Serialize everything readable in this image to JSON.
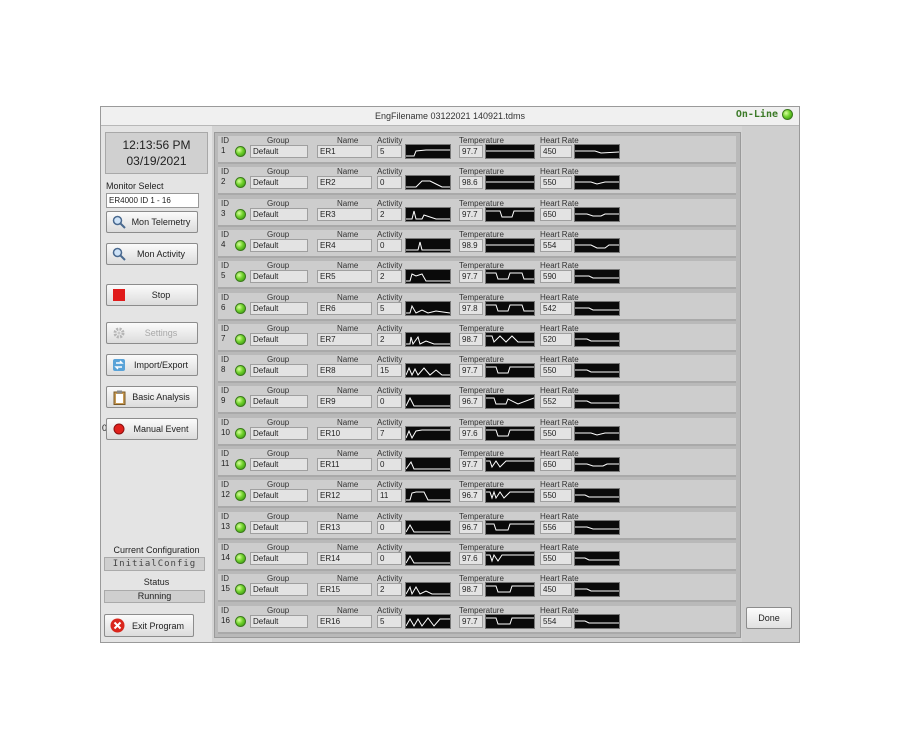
{
  "window": {
    "title": "EngFilename 03122021 140921.tdms",
    "online_label": "On-Line"
  },
  "left_panel": {
    "time": "12:13:56 PM",
    "date": "03/19/2021",
    "monitor_select_label": "Monitor Select",
    "monitor_select_value": "ER4000 ID 1 - 16",
    "buttons": [
      {
        "label": "Mon Telemetry",
        "icon": "magnifier-icon"
      },
      {
        "label": "Mon Activity",
        "icon": "magnifier-icon"
      },
      {
        "label": "Stop",
        "icon": "stop-square-icon"
      },
      {
        "label": "Settings",
        "icon": "gear-icon"
      },
      {
        "label": "Import/Export",
        "icon": "import-export-icon"
      },
      {
        "label": "Basic Analysis",
        "icon": "clipboard-icon"
      },
      {
        "label": "Manual Event",
        "icon": "red-dot-icon"
      }
    ],
    "manual_event_count": "0",
    "current_config_label": "Current Configuration",
    "current_config_value": "InitialConfig",
    "status_label": "Status",
    "status_value": "Running",
    "exit_label": "Exit Program"
  },
  "headers": {
    "id": "ID",
    "group": "Group",
    "name": "Name",
    "activity": "Activity",
    "temperature": "Temperature",
    "heart_rate": "Heart Rate"
  },
  "monitors": [
    {
      "id": "1",
      "group": "Default",
      "name": "ER1",
      "activity": "5",
      "temperature": "97.7",
      "heart_rate": "450"
    },
    {
      "id": "2",
      "group": "Default",
      "name": "ER2",
      "activity": "0",
      "temperature": "98.6",
      "heart_rate": "550"
    },
    {
      "id": "3",
      "group": "Default",
      "name": "ER3",
      "activity": "2",
      "temperature": "97.7",
      "heart_rate": "650"
    },
    {
      "id": "4",
      "group": "Default",
      "name": "ER4",
      "activity": "0",
      "temperature": "98.9",
      "heart_rate": "554"
    },
    {
      "id": "5",
      "group": "Default",
      "name": "ER5",
      "activity": "2",
      "temperature": "97.7",
      "heart_rate": "590"
    },
    {
      "id": "6",
      "group": "Default",
      "name": "ER6",
      "activity": "5",
      "temperature": "97.8",
      "heart_rate": "542"
    },
    {
      "id": "7",
      "group": "Default",
      "name": "ER7",
      "activity": "2",
      "temperature": "98.7",
      "heart_rate": "520"
    },
    {
      "id": "8",
      "group": "Default",
      "name": "ER8",
      "activity": "15",
      "temperature": "97.7",
      "heart_rate": "550"
    },
    {
      "id": "9",
      "group": "Default",
      "name": "ER9",
      "activity": "0",
      "temperature": "96.7",
      "heart_rate": "552"
    },
    {
      "id": "10",
      "group": "Default",
      "name": "ER10",
      "activity": "7",
      "temperature": "97.6",
      "heart_rate": "550"
    },
    {
      "id": "11",
      "group": "Default",
      "name": "ER11",
      "activity": "0",
      "temperature": "97.7",
      "heart_rate": "650"
    },
    {
      "id": "12",
      "group": "Default",
      "name": "ER12",
      "activity": "11",
      "temperature": "96.7",
      "heart_rate": "550"
    },
    {
      "id": "13",
      "group": "Default",
      "name": "ER13",
      "activity": "0",
      "temperature": "96.7",
      "heart_rate": "556"
    },
    {
      "id": "14",
      "group": "Default",
      "name": "ER14",
      "activity": "0",
      "temperature": "97.6",
      "heart_rate": "550"
    },
    {
      "id": "15",
      "group": "Default",
      "name": "ER15",
      "activity": "2",
      "temperature": "98.7",
      "heart_rate": "450"
    },
    {
      "id": "16",
      "group": "Default",
      "name": "ER16",
      "activity": "5",
      "temperature": "97.7",
      "heart_rate": "554"
    }
  ],
  "done_label": "Done",
  "colors": {
    "led_on": "#6fd12b",
    "online_text": "#3c7a28",
    "stop_red": "#e01b1b",
    "exit_red": "#d9261c",
    "sparkline": "#ffffff"
  }
}
